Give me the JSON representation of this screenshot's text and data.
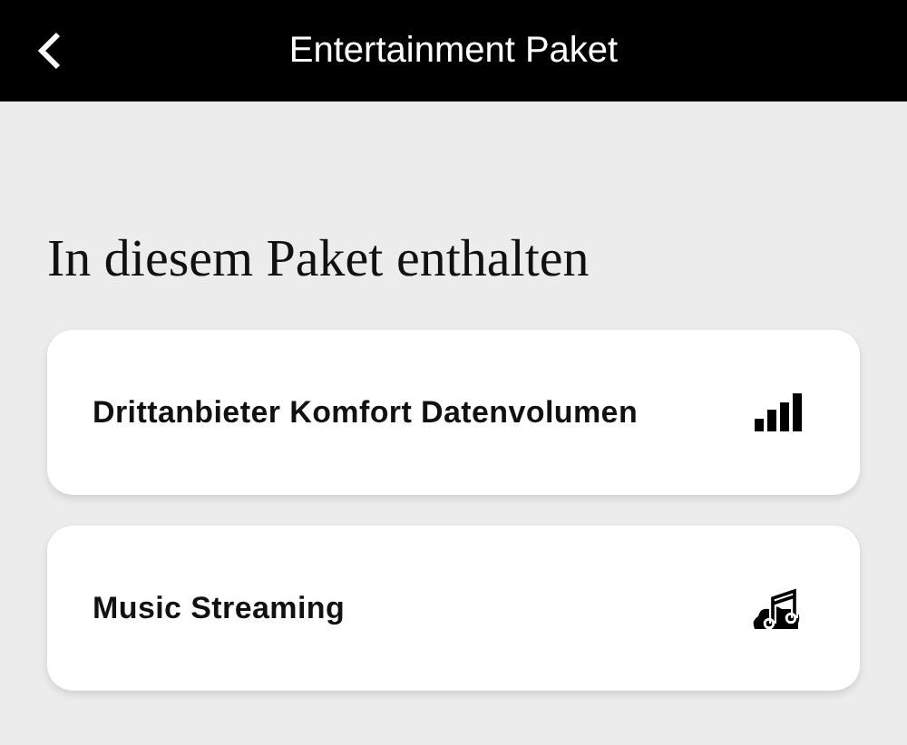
{
  "header": {
    "title": "Entertainment Paket"
  },
  "section": {
    "title": "In diesem Paket enthalten"
  },
  "items": [
    {
      "label": "Drittanbieter Komfort Datenvolumen",
      "kind": "data"
    },
    {
      "label": "Music Streaming",
      "kind": "music"
    }
  ]
}
